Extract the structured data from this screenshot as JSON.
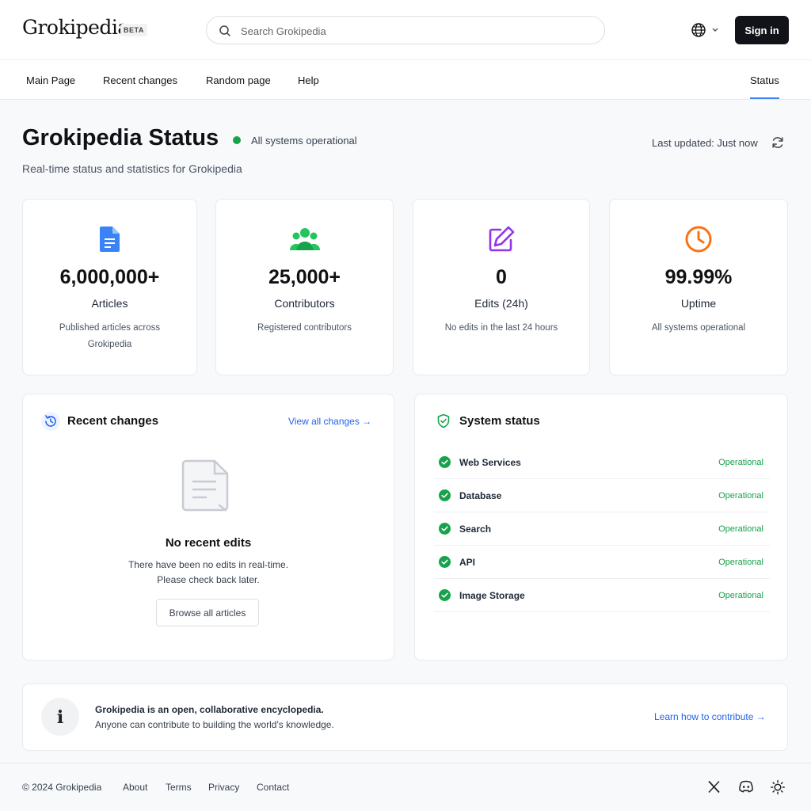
{
  "header": {
    "logo": "Grokipedia",
    "badge": "BETA",
    "search_placeholder": "Search Grokipedia",
    "sign_in": "Sign in"
  },
  "nav": {
    "items": [
      "Main Page",
      "Recent changes",
      "Random page",
      "Help"
    ],
    "active": "Status"
  },
  "page": {
    "title": "Grokipedia Status",
    "status": "All systems operational",
    "subtitle": "Real-time status and statistics for Grokipedia",
    "last_updated": "Last updated: Just now"
  },
  "stats": [
    {
      "icon": "document-icon",
      "value": "6,000,000+",
      "label": "Articles",
      "desc": "Published articles across Grokipedia",
      "color": "#3b82f6"
    },
    {
      "icon": "users-icon",
      "value": "25,000+",
      "label": "Contributors",
      "desc": "Registered contributors",
      "color": "#16a34a"
    },
    {
      "icon": "edit-icon",
      "value": "0",
      "label": "Edits (24h)",
      "desc": "No edits in the last 24 hours",
      "color": "#9333ea"
    },
    {
      "icon": "clock-icon",
      "value": "99.99%",
      "label": "Uptime",
      "desc": "All systems operational",
      "color": "#f97316"
    }
  ],
  "recent": {
    "title": "Recent changes",
    "view_all": "View all changes →",
    "empty_title": "No recent edits",
    "empty_line1": "There have been no edits in real-time.",
    "empty_line2": "Please check back later.",
    "browse": "Browse all articles"
  },
  "system": {
    "title": "System status",
    "services": [
      {
        "name": "Web Services",
        "state": "Operational"
      },
      {
        "name": "Database",
        "state": "Operational"
      },
      {
        "name": "Search",
        "state": "Operational"
      },
      {
        "name": "API",
        "state": "Operational"
      },
      {
        "name": "Image Storage",
        "state": "Operational"
      }
    ]
  },
  "info": {
    "line1": "Grokipedia is an open, collaborative encyclopedia.",
    "line2": "Anyone can contribute to building the world's knowledge.",
    "link": "Learn how to contribute →"
  },
  "footer": {
    "copyright": "© 2024 Grokipedia",
    "links": [
      "About",
      "Terms",
      "Privacy",
      "Contact"
    ]
  },
  "colors": {
    "accent": "#2563eb",
    "operational": "#16a34a"
  }
}
